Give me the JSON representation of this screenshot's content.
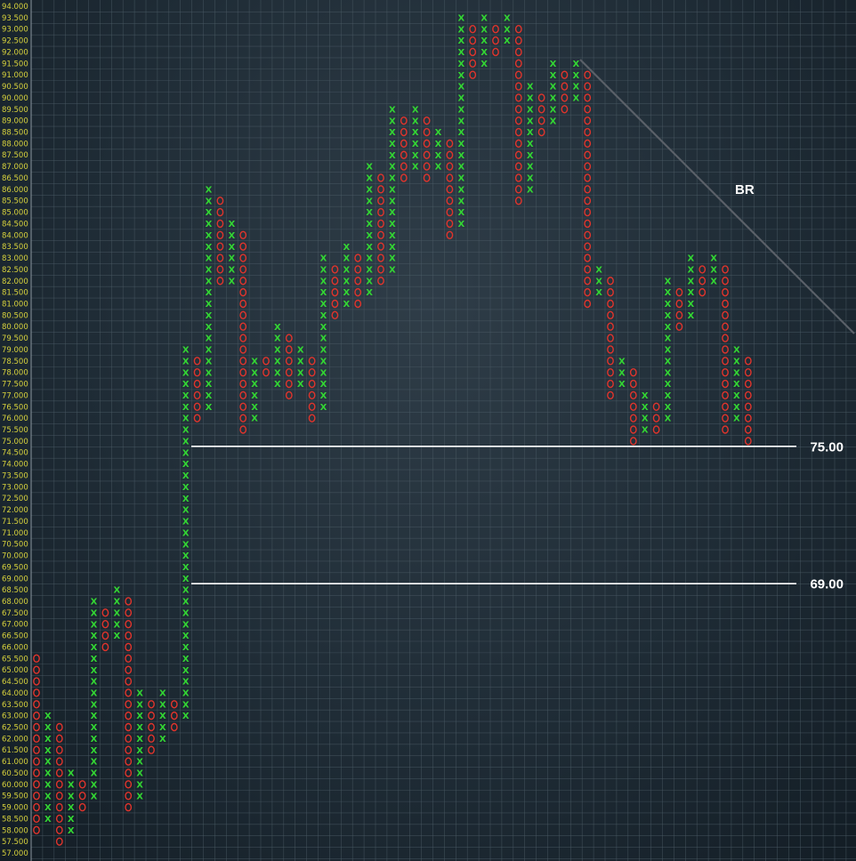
{
  "chart_data": {
    "type": "point-and-figure",
    "box_size": 0.5,
    "y_range": [
      57.0,
      94.0
    ],
    "grid": true,
    "colors": {
      "x": "#33d633",
      "o": "#e0342c",
      "axis_text": "#d7d23c",
      "grid": "#4d5c67",
      "lines": "#ffffff",
      "trendline": "#5a6068"
    },
    "y_ticks_step": 0.5,
    "columns": [
      {
        "type": "O",
        "top": 65.5,
        "bottom": 58.0
      },
      {
        "type": "X",
        "top": 63.0,
        "bottom": 58.5
      },
      {
        "type": "O",
        "top": 62.5,
        "bottom": 57.5
      },
      {
        "type": "X",
        "top": 60.5,
        "bottom": 58.0
      },
      {
        "type": "O",
        "top": 60.0,
        "bottom": 59.0
      },
      {
        "type": "X",
        "top": 68.0,
        "bottom": 59.5
      },
      {
        "type": "O",
        "top": 67.5,
        "bottom": 66.0
      },
      {
        "type": "X",
        "top": 68.5,
        "bottom": 66.5
      },
      {
        "type": "O",
        "top": 68.0,
        "bottom": 59.0
      },
      {
        "type": "X",
        "top": 64.0,
        "bottom": 59.5
      },
      {
        "type": "O",
        "top": 63.5,
        "bottom": 61.5
      },
      {
        "type": "X",
        "top": 64.0,
        "bottom": 62.0
      },
      {
        "type": "O",
        "top": 63.5,
        "bottom": 62.5
      },
      {
        "type": "X",
        "top": 79.0,
        "bottom": 63.0
      },
      {
        "type": "O",
        "top": 78.5,
        "bottom": 76.0
      },
      {
        "type": "X",
        "top": 86.0,
        "bottom": 76.5
      },
      {
        "type": "O",
        "top": 85.5,
        "bottom": 82.0
      },
      {
        "type": "X",
        "top": 84.5,
        "bottom": 82.0
      },
      {
        "type": "O",
        "top": 84.0,
        "bottom": 75.5
      },
      {
        "type": "X",
        "top": 78.5,
        "bottom": 76.0
      },
      {
        "type": "O",
        "top": 78.5,
        "bottom": 78.0
      },
      {
        "type": "X",
        "top": 80.0,
        "bottom": 77.5
      },
      {
        "type": "O",
        "top": 79.5,
        "bottom": 77.0
      },
      {
        "type": "X",
        "top": 79.0,
        "bottom": 77.5
      },
      {
        "type": "O",
        "top": 78.5,
        "bottom": 76.0
      },
      {
        "type": "X",
        "top": 83.0,
        "bottom": 76.5
      },
      {
        "type": "O",
        "top": 82.5,
        "bottom": 80.5
      },
      {
        "type": "X",
        "top": 83.5,
        "bottom": 81.0
      },
      {
        "type": "O",
        "top": 83.0,
        "bottom": 81.0
      },
      {
        "type": "X",
        "top": 87.0,
        "bottom": 81.5
      },
      {
        "type": "O",
        "top": 86.5,
        "bottom": 82.0
      },
      {
        "type": "X",
        "top": 89.5,
        "bottom": 82.5
      },
      {
        "type": "O",
        "top": 89.0,
        "bottom": 86.5
      },
      {
        "type": "X",
        "top": 89.5,
        "bottom": 87.0
      },
      {
        "type": "O",
        "top": 89.0,
        "bottom": 86.5
      },
      {
        "type": "X",
        "top": 88.5,
        "bottom": 87.0
      },
      {
        "type": "O",
        "top": 88.0,
        "bottom": 84.0
      },
      {
        "type": "X",
        "top": 93.5,
        "bottom": 84.5
      },
      {
        "type": "O",
        "top": 93.0,
        "bottom": 91.0
      },
      {
        "type": "X",
        "top": 93.5,
        "bottom": 91.5
      },
      {
        "type": "O",
        "top": 93.0,
        "bottom": 92.0
      },
      {
        "type": "X",
        "top": 93.5,
        "bottom": 92.5
      },
      {
        "type": "O",
        "top": 93.0,
        "bottom": 85.5
      },
      {
        "type": "X",
        "top": 90.5,
        "bottom": 86.0
      },
      {
        "type": "O",
        "top": 90.0,
        "bottom": 88.5
      },
      {
        "type": "X",
        "top": 91.5,
        "bottom": 89.0
      },
      {
        "type": "O",
        "top": 91.0,
        "bottom": 89.5
      },
      {
        "type": "X",
        "top": 91.5,
        "bottom": 90.0
      },
      {
        "type": "O",
        "top": 91.0,
        "bottom": 81.0
      },
      {
        "type": "X",
        "top": 82.5,
        "bottom": 81.5
      },
      {
        "type": "O",
        "top": 82.0,
        "bottom": 77.0
      },
      {
        "type": "X",
        "top": 78.5,
        "bottom": 77.5
      },
      {
        "type": "O",
        "top": 78.0,
        "bottom": 75.0
      },
      {
        "type": "X",
        "top": 77.0,
        "bottom": 75.5
      },
      {
        "type": "O",
        "top": 76.5,
        "bottom": 75.5
      },
      {
        "type": "X",
        "top": 82.0,
        "bottom": 76.0
      },
      {
        "type": "O",
        "top": 81.5,
        "bottom": 80.0
      },
      {
        "type": "X",
        "top": 83.0,
        "bottom": 80.5
      },
      {
        "type": "O",
        "top": 82.5,
        "bottom": 81.5
      },
      {
        "type": "X",
        "top": 83.0,
        "bottom": 82.0
      },
      {
        "type": "O",
        "top": 82.5,
        "bottom": 75.5
      },
      {
        "type": "X",
        "top": 79.0,
        "bottom": 76.0
      },
      {
        "type": "O",
        "top": 78.5,
        "bottom": 75.0
      }
    ],
    "horizontal_lines": [
      {
        "value": 75.0,
        "label": "75.00"
      },
      {
        "value": 69.0,
        "label": "69.00"
      }
    ],
    "annotations": [
      {
        "text": "BR"
      }
    ]
  }
}
